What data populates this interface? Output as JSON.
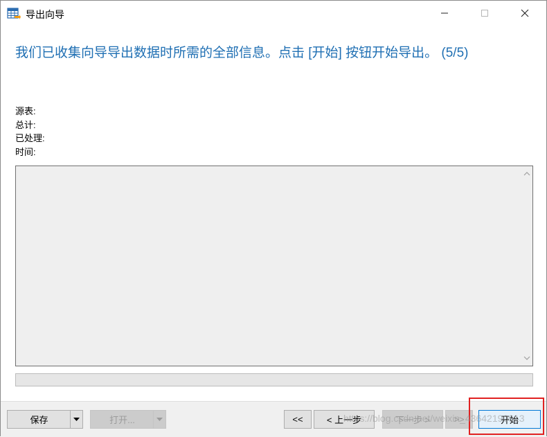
{
  "window": {
    "title": "导出向导",
    "app_icon": "table-export-icon",
    "controls": {
      "minimize": "minimize-icon",
      "maximize": "maximize-icon",
      "close": "close-icon"
    }
  },
  "wizard": {
    "heading": "我们已收集向导导出数据时所需的全部信息。点击 [开始] 按钮开始导出。 (5/5)",
    "info": {
      "source_table_label": "源表:",
      "total_label": "总计:",
      "processed_label": "已处理:",
      "time_label": "时间:"
    },
    "progress_value": 0
  },
  "footer": {
    "save_label": "保存",
    "open_label": "打开...",
    "first_label": "<<",
    "prev_label": "< 上一步",
    "next_label": "下一步 >",
    "last_label": ">>",
    "start_label": "开始"
  },
  "watermark": "https://blog.csdn.net/weixin_43642190013",
  "colors": {
    "heading": "#1f6fb3",
    "highlight": "#e02020",
    "footer_bg": "#f0f0f0"
  }
}
